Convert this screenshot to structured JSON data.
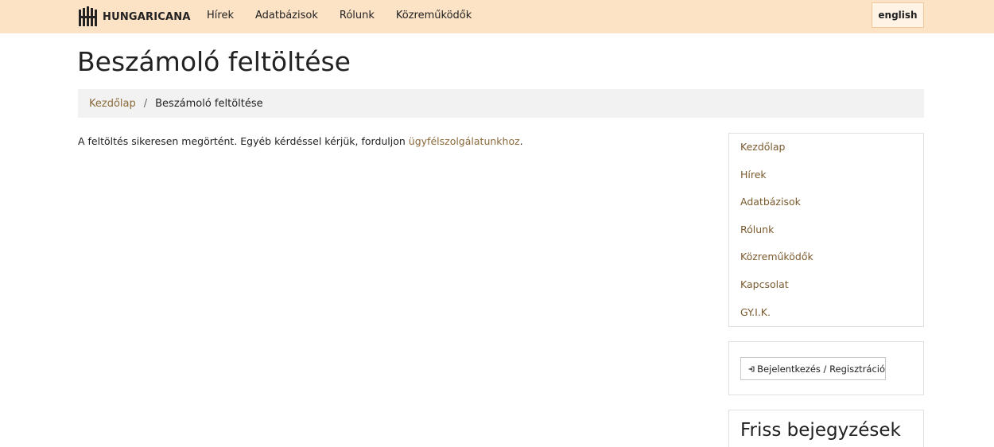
{
  "header": {
    "logo_text": "HUNGARICANA",
    "nav": [
      "Hírek",
      "Adatbázisok",
      "Rólunk",
      "Közreműködők"
    ],
    "lang_button": "english"
  },
  "page": {
    "title": "Beszámoló feltöltése"
  },
  "breadcrumb": {
    "home": "Kezdőlap",
    "separator": "/",
    "current": "Beszámoló feltöltése"
  },
  "message": {
    "text_before": "A feltöltés sikeresen megörtént. Egyéb kérdéssel kérjük, forduljon ",
    "link": "ügyfélszolgálatunkhoz",
    "text_after": "."
  },
  "sidebar": {
    "menu": [
      "Kezdőlap",
      "Hírek",
      "Adatbázisok",
      "Rólunk",
      "Közreműködők",
      "Kapcsolat",
      "GY.I.K."
    ],
    "login_button": "Bejelentkezés / Regisztráció",
    "recent_title": "Friss bejegyzések"
  },
  "colors": {
    "navbar_bg": "#fde3c6",
    "link": "#8a6a3a",
    "breadcrumb_bg": "#f2f2f2"
  }
}
